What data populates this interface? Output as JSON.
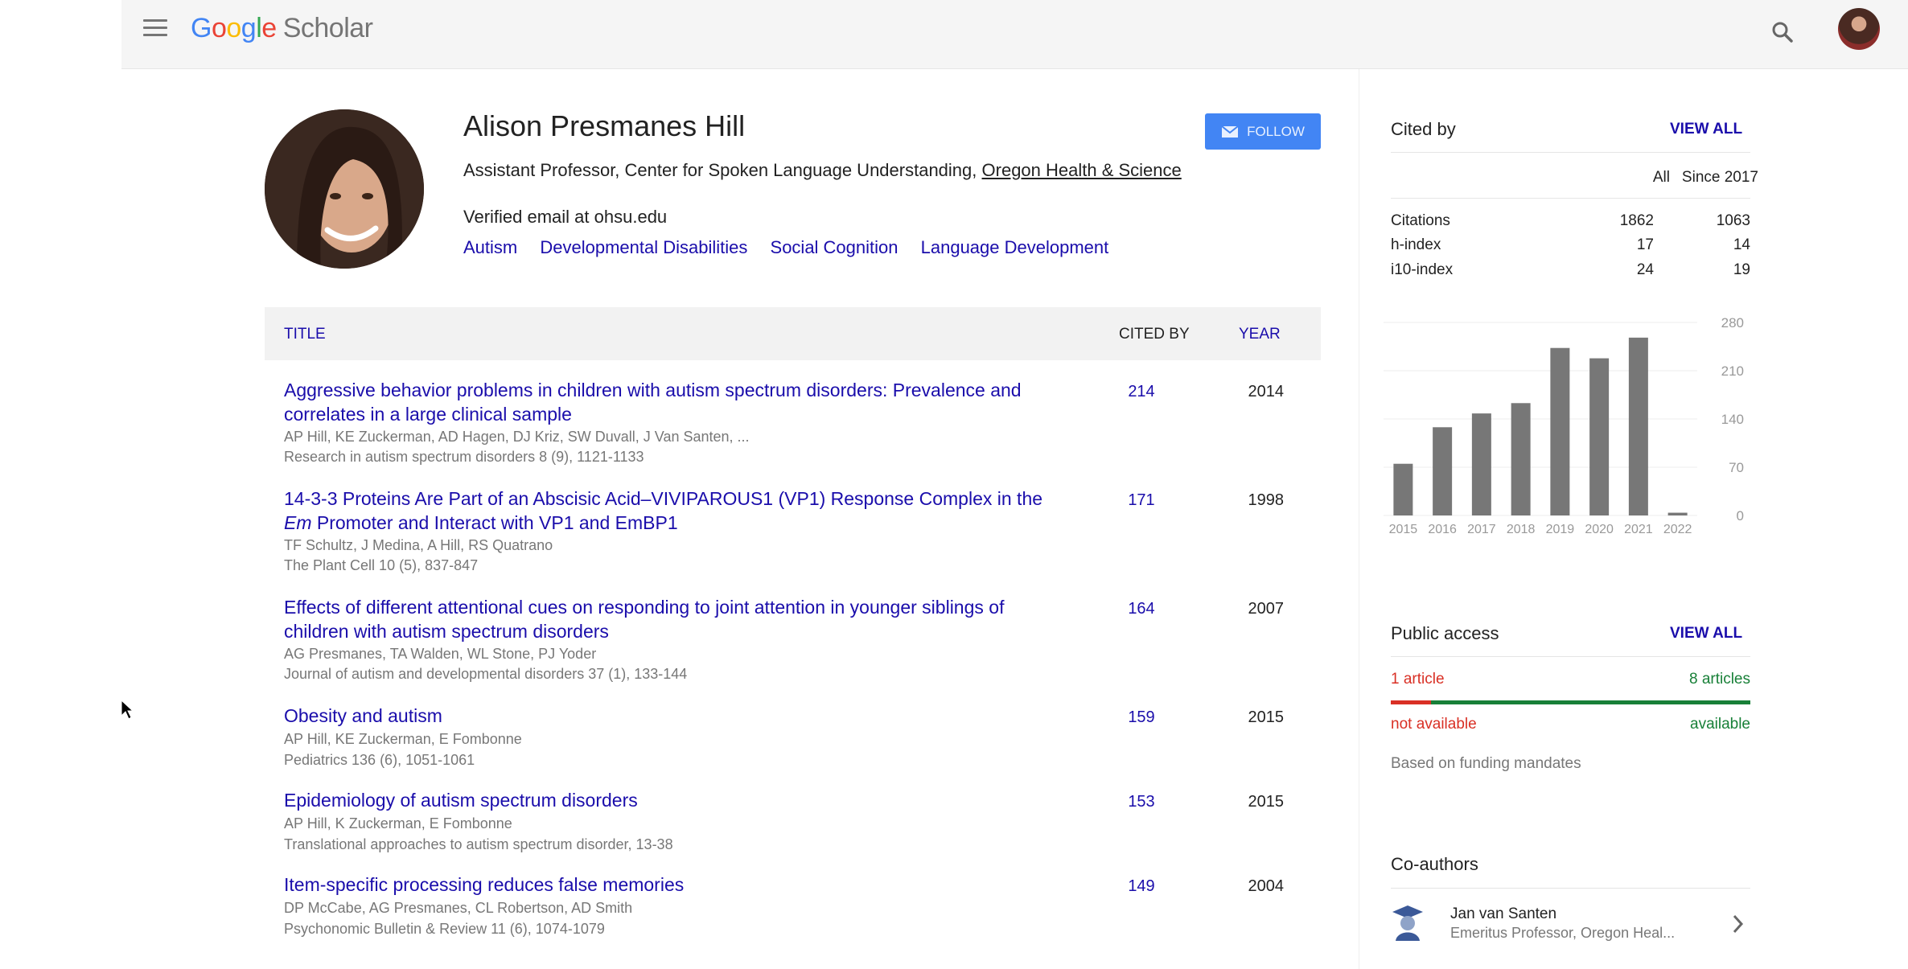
{
  "topbar": {
    "logo_google": [
      "G",
      "o",
      "o",
      "g",
      "l",
      "e"
    ],
    "logo_scholar": "Scholar"
  },
  "profile": {
    "name": "Alison Presmanes Hill",
    "affiliation_prefix": "Assistant Professor, Center for Spoken Language Understanding,",
    "affiliation_link": "Oregon Health & Science",
    "email": "Verified email at ohsu.edu",
    "interests": [
      "Autism",
      "Developmental Disabilities",
      "Social Cognition",
      "Language Development"
    ],
    "follow_label": "FOLLOW"
  },
  "table": {
    "col_title": "TITLE",
    "col_cited": "CITED BY",
    "col_year": "YEAR",
    "rows": [
      {
        "title_line1": "Aggressive behavior problems in children with autism spectrum disorders: Prevalence and",
        "title_line2": "correlates in a large clinical sample",
        "authors": "AP Hill, KE Zuckerman, AD Hagen, DJ Kriz, SW Duvall, J Van Santen, ...",
        "venue": "Research in autism spectrum disorders 8 (9), 1121-1133",
        "cited": "214",
        "year": "2014"
      },
      {
        "title_line1": "14-3-3 Proteins Are Part of an Abscisic Acid–VIVIPAROUS1 (VP1) Response Complex in the",
        "title_line2_em": "Em",
        "title_line2": " Promoter and Interact with VP1 and EmBP1",
        "authors": "TF Schultz, J Medina, A Hill, RS Quatrano",
        "venue": "The Plant Cell 10 (5), 837-847",
        "cited": "171",
        "year": "1998"
      },
      {
        "title_line1": "Effects of different attentional cues on responding to joint attention in younger siblings of",
        "title_line2": "children with autism spectrum disorders",
        "authors": "AG Presmanes, TA Walden, WL Stone, PJ Yoder",
        "venue": "Journal of autism and developmental disorders 37 (1), 133-144",
        "cited": "164",
        "year": "2007"
      },
      {
        "title_line1": "Obesity and autism",
        "title_line2": "",
        "authors": "AP Hill, KE Zuckerman, E Fombonne",
        "venue": "Pediatrics 136 (6), 1051-1061",
        "cited": "159",
        "year": "2015"
      },
      {
        "title_line1": "Epidemiology of autism spectrum disorders",
        "title_line2": "",
        "authors": "AP Hill, K Zuckerman, E Fombonne",
        "venue": "Translational approaches to autism spectrum disorder, 13-38",
        "cited": "153",
        "year": "2015"
      },
      {
        "title_line1": "Item-specific processing reduces false memories",
        "title_line2": "",
        "authors": "DP McCabe, AG Presmanes, CL Robertson, AD Smith",
        "venue": "Psychonomic Bulletin & Review 11 (6), 1074-1079",
        "cited": "149",
        "year": "2004"
      }
    ]
  },
  "cited_by": {
    "title": "Cited by",
    "view_all": "VIEW ALL",
    "col_all": "All",
    "col_since": "Since 2017",
    "metrics": [
      {
        "label": "Citations",
        "all": "1862",
        "since": "1063"
      },
      {
        "label": "h-index",
        "all": "17",
        "since": "14"
      },
      {
        "label": "i10-index",
        "all": "24",
        "since": "19"
      }
    ]
  },
  "chart_data": {
    "type": "bar",
    "categories": [
      "2015",
      "2016",
      "2017",
      "2018",
      "2019",
      "2020",
      "2021",
      "2022"
    ],
    "values": [
      75,
      128,
      148,
      163,
      243,
      228,
      258,
      4
    ],
    "yticks": [
      0,
      70,
      140,
      210,
      280
    ],
    "ylim": [
      0,
      280
    ],
    "bar_color": "#777777"
  },
  "public_access": {
    "title": "Public access",
    "view_all": "VIEW ALL",
    "left_count": "1 article",
    "right_count": "8 articles",
    "left_label": "not available",
    "right_label": "available",
    "note": "Based on funding mandates",
    "fraction_not_available": 0.111,
    "color_not_available": "#d93025",
    "color_available": "#188038"
  },
  "coauthors": {
    "title": "Co-authors",
    "items": [
      {
        "name": "Jan van Santen",
        "affiliation": "Emeritus Professor, Oregon Heal..."
      }
    ]
  }
}
